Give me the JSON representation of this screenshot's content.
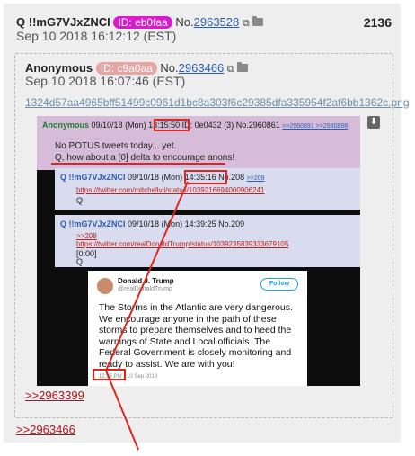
{
  "post": {
    "name": "Q",
    "trip": "!!mG7VJxZNCI",
    "id": "ID: eb0faa",
    "no_prefix": "No.",
    "no": "2963528",
    "reply_count": "2136",
    "date": "Sep 10 2018 16:12:12 (EST)"
  },
  "quoted": {
    "name": "Anonymous",
    "id": "ID: c9a0aa",
    "no_prefix": "No.",
    "no": "2963466",
    "date": "Sep 10 2018 16:07:46 (EST)",
    "filename": "1324d57aa4965bff51499c0961d1bc8a303f6c29385dfa335954f2af6bb1362c.png"
  },
  "shot": {
    "p1": {
      "name": "Anonymous",
      "date": "09/10/18 (Mon)",
      "time": "13:15:50",
      "id": "ID: 0e0432 (3)",
      "no": "No.2960861",
      "refs": ">>2960891  >>2960898",
      "line1": "No POTUS tweets today... yet.",
      "line2": "Q, how about a [0] delta to encourage anons!"
    },
    "p2": {
      "name": "Q !!mG7VJxZNCI",
      "date": "09/10/18 (Mon)",
      "time": "14:35:16",
      "no": "No.208",
      "ref": ">>209",
      "link": "https://twitter.com/mitchellvii/status/1039216694000906241",
      "sig": "Q"
    },
    "p3": {
      "name": "Q !!mG7VJxZNCI",
      "header": "09/10/18 (Mon) 14:39:25 No.209",
      "ref": ">>208",
      "link": "https://twitter.com/realDonaldTrump/status/1039235839333679105",
      "delta": "[0:00]",
      "sig": "Q"
    },
    "tweet": {
      "name": "Donald J. Trump",
      "handle": "@realDonaldTrump",
      "follow": "Follow",
      "text": "The Storms in the Atlantic are very dangerous. We encourage anyone in the path of these storms to prepare themselves and to heed the warnings of State and Local officials. The Federal Government is closely monitoring and ready to assist. We are with you!",
      "time": "12:35 PM",
      "date": "10 Sep 2018"
    }
  },
  "backlinks": {
    "inner": ">>2963399",
    "outer": ">>2963466"
  },
  "colors": {
    "id_main": "#d81bcd",
    "id_quote": "#e8a3a3",
    "link": "#2a5db0",
    "backlink": "#b5121b",
    "highlight": "#e0261c"
  }
}
